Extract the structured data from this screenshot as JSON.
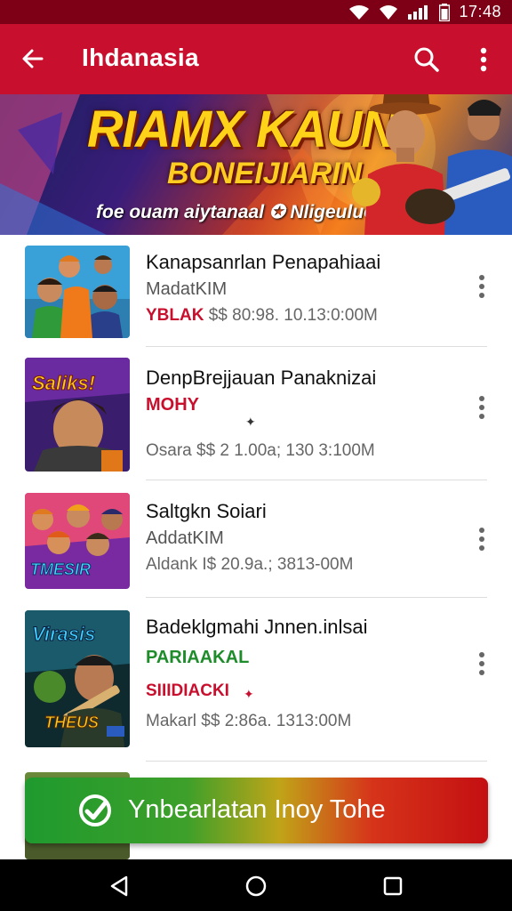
{
  "status_bar": {
    "time": "17:48",
    "icons": [
      "wifi-icon",
      "signal-icon",
      "signal-bars-icon",
      "battery-icon"
    ]
  },
  "app_bar": {
    "title": "Ihdanasia",
    "back_icon": "arrow-left-icon",
    "search_icon": "search-icon",
    "more_icon": "more-vertical-icon"
  },
  "banner": {
    "title": "RIAMX KAUN",
    "subtitle": "BONEIJIARIN",
    "tagline": "foe ouam aiytanaal ✪ Nligeuluokcjan"
  },
  "list": [
    {
      "title": "Kanapsanrlan Penapahiaai",
      "line2_label": "MadatKIM",
      "line3_tag": "YBLAK",
      "line3_text": " $$ 80:98. 10.13:0:00M",
      "menu_icon": "more-vertical-icon"
    },
    {
      "title": "DenpBrejjauan Panaknizai",
      "line2_label": "MOHY",
      "line3_tag": "",
      "line3_text": "Osara $$ 2 1.00a; 130 3:100M",
      "menu_icon": "more-vertical-icon"
    },
    {
      "title": "Saltgkn Soiari",
      "line2_label": "AddatKIM",
      "line3_tag": "",
      "line3_text": "Aldank I$ 20.9a.; 3813-00M",
      "menu_icon": "more-vertical-icon"
    },
    {
      "title": "Badeklgmahi Jnnen.inlsai",
      "line2_label": "PARIAAKAL",
      "line3_tag": "SIIIDIACKI",
      "line3_text": "Makarl $$ 2:86a. 1313:00M",
      "menu_icon": "more-vertical-icon"
    }
  ],
  "cta": {
    "label": "Ynbearlatan Inoy Tohe",
    "icon": "check-circle-icon"
  },
  "nav_bar": {
    "back": "nav-back-icon",
    "home": "nav-home-icon",
    "recents": "nav-recents-icon"
  },
  "colors": {
    "app_bar": "#c8102e",
    "status_bar": "#7d0016",
    "accent_green": "#1f9a2e",
    "accent_red": "#c40f12"
  }
}
